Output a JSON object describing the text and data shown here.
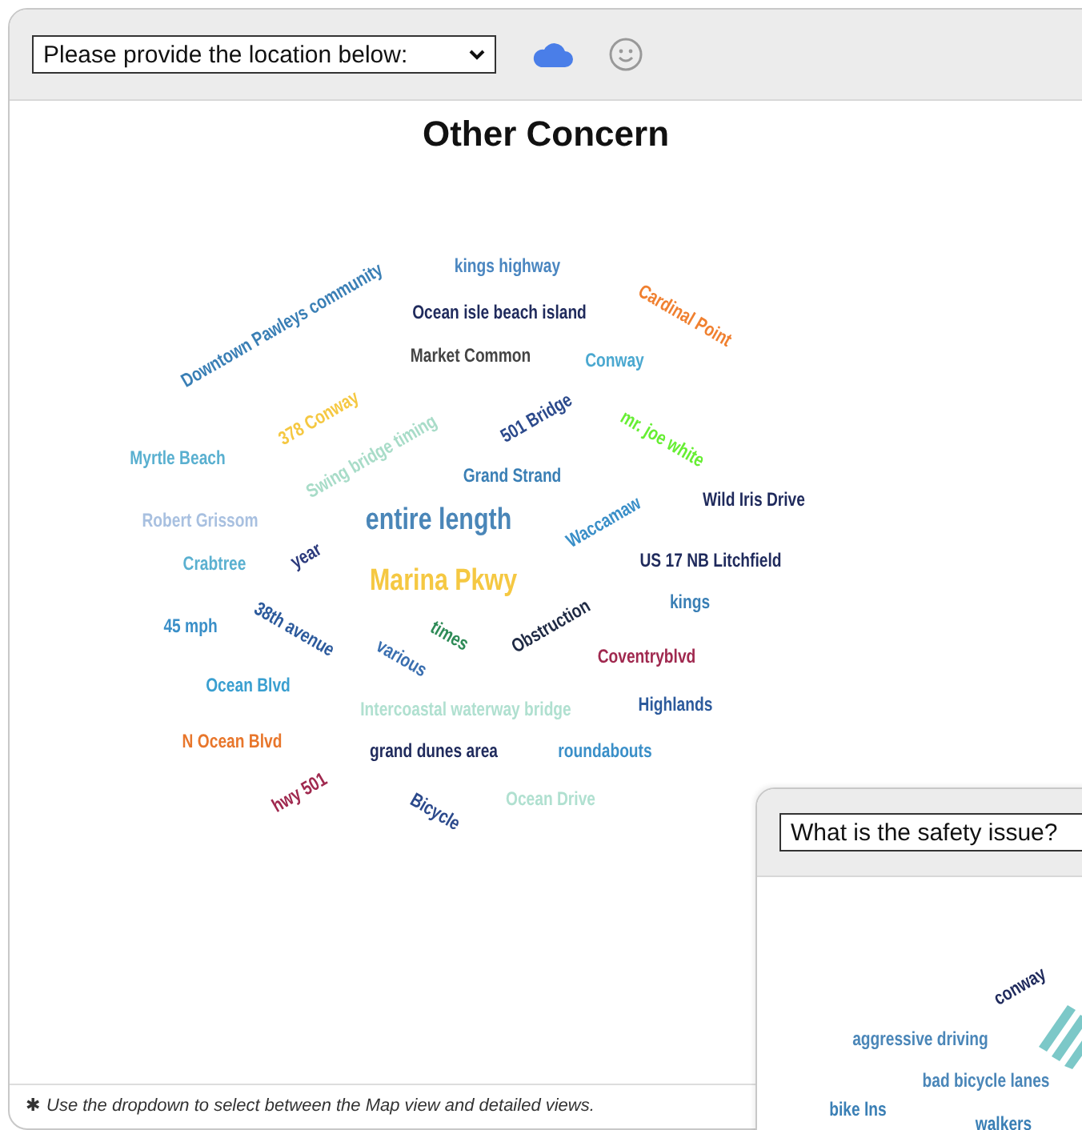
{
  "main_panel": {
    "dropdown": {
      "value": "Please provide the location below:"
    },
    "title": "Other Concern",
    "words": [
      {
        "text": "Downtown Pawleys community",
        "color": "#3a7fb5"
      },
      {
        "text": "kings highway",
        "color": "#4a86c0"
      },
      {
        "text": "Ocean isle beach island",
        "color": "#1f2a5c"
      },
      {
        "text": "Cardinal Point",
        "color": "#f08030"
      },
      {
        "text": "Market Common",
        "color": "#444444"
      },
      {
        "text": "Conway",
        "color": "#4aa8d0"
      },
      {
        "text": "378 Conway",
        "color": "#f5c842"
      },
      {
        "text": "Swing bridge timing",
        "color": "#a8dcc8"
      },
      {
        "text": "501 Bridge",
        "color": "#2c4a8c"
      },
      {
        "text": "mr. joe white",
        "color": "#66ee33"
      },
      {
        "text": "Myrtle Beach",
        "color": "#5ab0d0"
      },
      {
        "text": "Grand Strand",
        "color": "#3a7fb5"
      },
      {
        "text": "Wild Iris Drive",
        "color": "#1f2a5c"
      },
      {
        "text": "Robert Grissom",
        "color": "#a8c0e0"
      },
      {
        "text": "entire length",
        "color": "#4a86b8"
      },
      {
        "text": "Waccamaw",
        "color": "#3a8fc8"
      },
      {
        "text": "Crabtree",
        "color": "#5ab0d0"
      },
      {
        "text": "year",
        "color": "#2c3a7c"
      },
      {
        "text": "US 17 NB Litchfield",
        "color": "#1f2a5c"
      },
      {
        "text": "Marina Pkwy",
        "color": "#f5c842"
      },
      {
        "text": "kings",
        "color": "#3a7fb5"
      },
      {
        "text": "45 mph",
        "color": "#3a8fc8"
      },
      {
        "text": "38th avenue",
        "color": "#2c5a9c"
      },
      {
        "text": "times",
        "color": "#2e8b57"
      },
      {
        "text": "Obstruction",
        "color": "#1f2a44"
      },
      {
        "text": "various",
        "color": "#3a6fb0"
      },
      {
        "text": "Coventryblvd",
        "color": "#a0294f"
      },
      {
        "text": "Ocean Blvd",
        "color": "#3a9fd0"
      },
      {
        "text": "Intercoastal waterway bridge",
        "color": "#b0e0d0"
      },
      {
        "text": "Highlands",
        "color": "#2c5a9c"
      },
      {
        "text": "N Ocean Blvd",
        "color": "#e8762b"
      },
      {
        "text": "grand dunes area",
        "color": "#1f2a5c"
      },
      {
        "text": "roundabouts",
        "color": "#3a8fc8"
      },
      {
        "text": "hwy 501",
        "color": "#a0294f"
      },
      {
        "text": "Bicycle",
        "color": "#2c4a8c"
      },
      {
        "text": "Ocean Drive",
        "color": "#b0e0d0"
      }
    ],
    "footer": {
      "marker": "✱",
      "note": "Use the dropdown to select between the Map view and detailed views."
    }
  },
  "second_panel": {
    "dropdown": {
      "value": "What is the safety issue?"
    },
    "words": [
      {
        "text": "conway",
        "color": "#1f2a5c"
      },
      {
        "text": "aggressive driving",
        "color": "#4a86b8"
      },
      {
        "text": "bad bicycle lanes",
        "color": "#4a86b8"
      },
      {
        "text": "bike lns",
        "color": "#3a7fb5"
      },
      {
        "text": "walkers",
        "color": "#3a7fb5"
      }
    ]
  }
}
